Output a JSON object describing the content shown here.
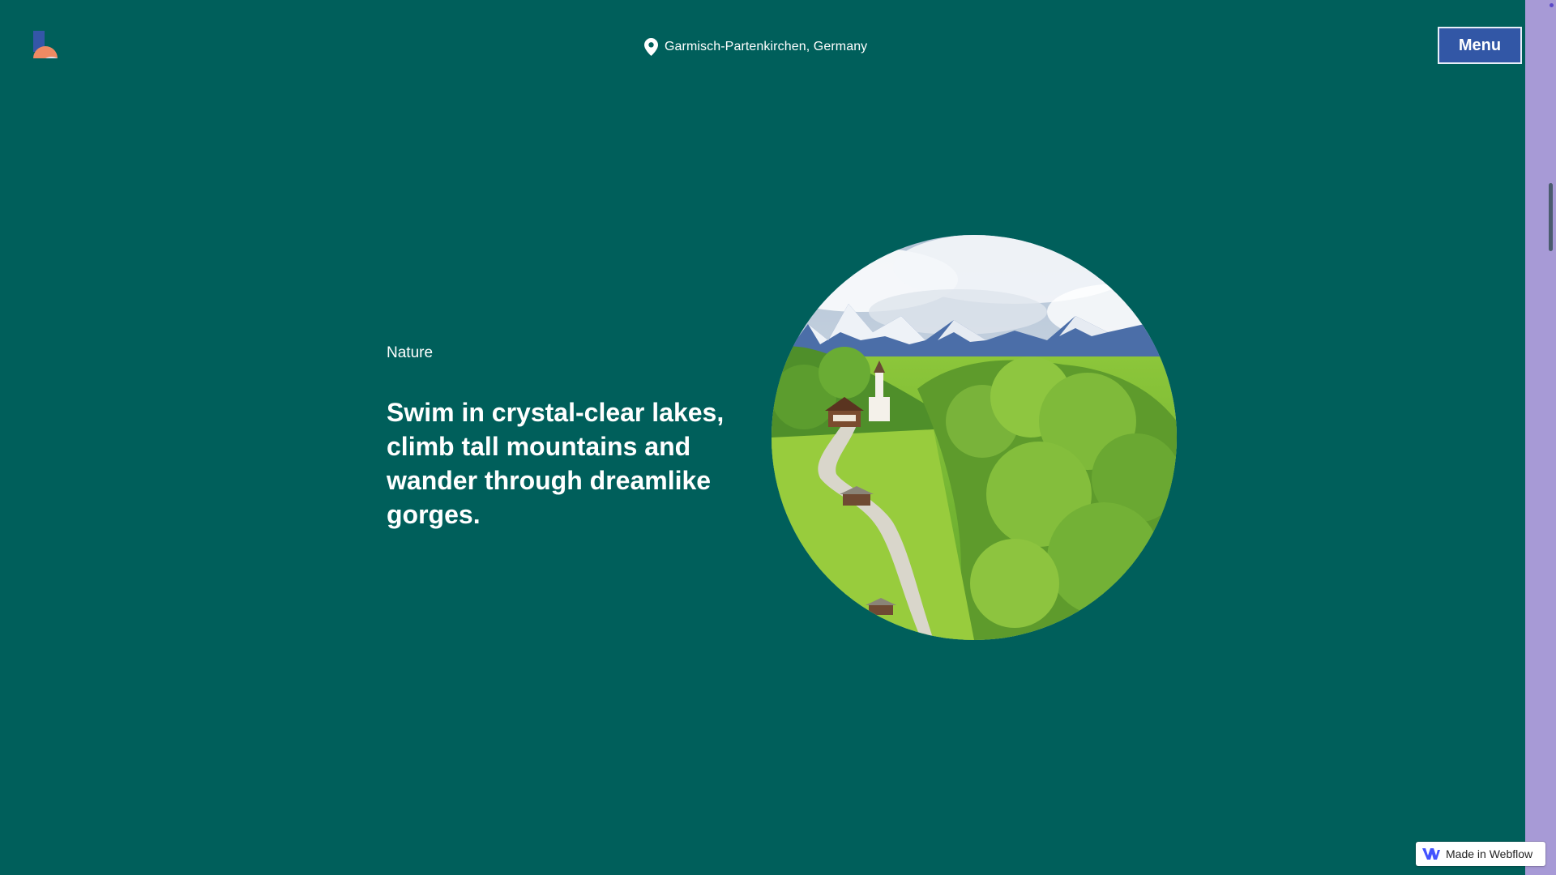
{
  "header": {
    "logo": "brand-logo",
    "location_icon": "map-pin-icon",
    "location": "Garmisch-Partenkirchen, Germany",
    "menu_label": "Menu"
  },
  "hero": {
    "eyebrow": "Nature",
    "headline": "Swim in crystal-clear lakes, climb tall mountains and wander through dreamlike gorges.",
    "image": "alpine-village-meadow-photo"
  },
  "badge": {
    "icon": "webflow-icon",
    "label": "Made in Webflow"
  },
  "colors": {
    "background": "#005f5b",
    "menu_button": "#3257a6",
    "scroll_rail": "#a79ad6",
    "text": "#ffffff"
  }
}
